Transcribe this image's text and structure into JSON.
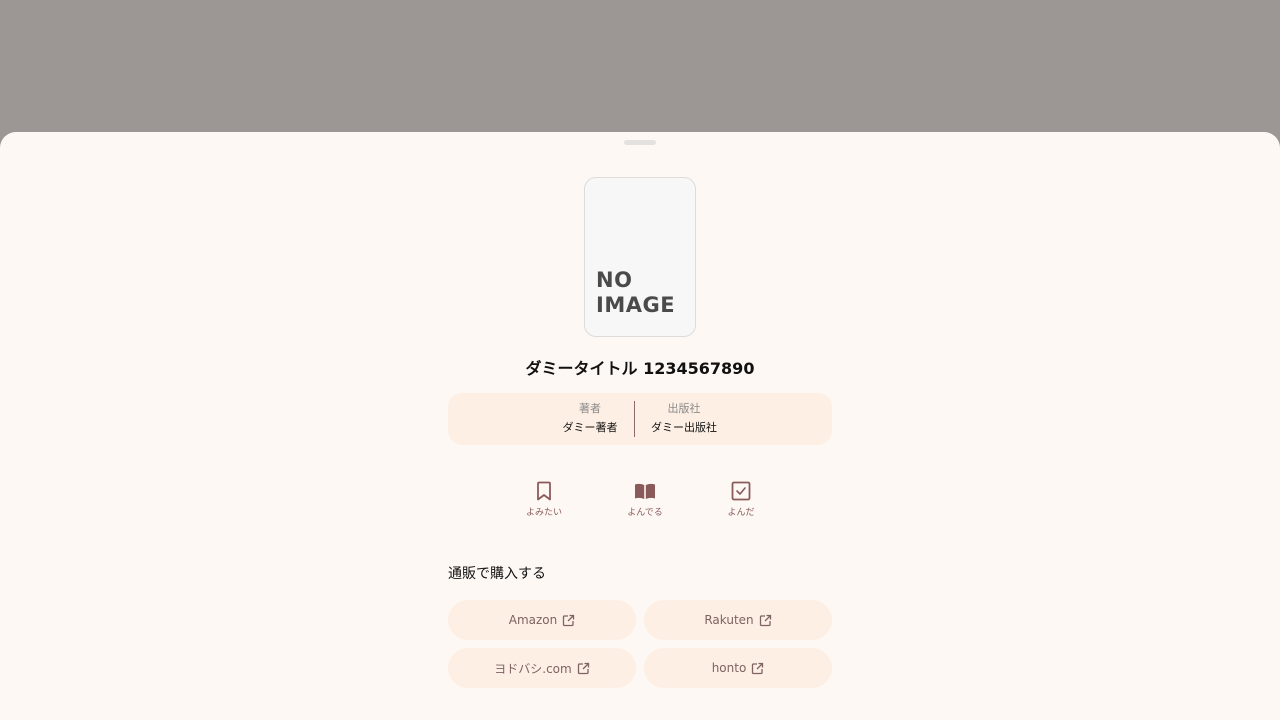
{
  "book": {
    "cover_text_line1": "NO",
    "cover_text_line2": "IMAGE",
    "title": "ダミータイトル 1234567890"
  },
  "meta": {
    "author_label": "著者",
    "author_value": "ダミー著者",
    "publisher_label": "出版社",
    "publisher_value": "ダミー出版社"
  },
  "status": {
    "want_label": "よみたい",
    "reading_label": "よんでる",
    "read_label": "よんだ",
    "active": "reading"
  },
  "purchase": {
    "section_title": "通販で購入する",
    "stores": [
      {
        "label": "Amazon"
      },
      {
        "label": "Rakuten"
      },
      {
        "label": "ヨドバシ.com"
      },
      {
        "label": "honto"
      }
    ]
  },
  "colors": {
    "overlay": "#9c9794",
    "sheet_bg": "#fdf8f4",
    "accent_bg": "#fdefe4",
    "accent": "#8a5a5a"
  }
}
